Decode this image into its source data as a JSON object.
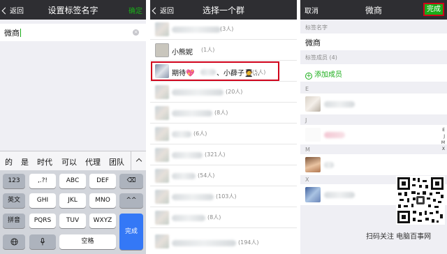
{
  "panel1": {
    "back_label": "返回",
    "title": "设置标签名字",
    "confirm_label": "确定",
    "input_value": "微商",
    "candidates": [
      "的",
      "是",
      "时代",
      "可以",
      "代理",
      "团队"
    ],
    "keys": {
      "row1": [
        "123",
        ",.?!",
        "ABC",
        "DEF"
      ],
      "row2": [
        "英文",
        "GHI",
        "JKL",
        "MNO"
      ],
      "row3": [
        "拼音",
        "PQRS",
        "TUV",
        "WXYZ"
      ],
      "space": "空格",
      "done": "完成"
    },
    "icons": {
      "backspace": "⌫",
      "emoji": "^^",
      "globe": "globe-icon",
      "mic": "microphone-icon"
    }
  },
  "panel2": {
    "back_label": "返回",
    "title": "选择一个群",
    "rows": [
      {
        "name": "",
        "count": "(3人)"
      },
      {
        "name": "小熊妮",
        "count": "(1人)"
      },
      {
        "name": "期待💖",
        "name_tail": "、小薛子🧑‍🎓...",
        "count": "(5人)"
      },
      {
        "name": "",
        "count": "(20人)"
      },
      {
        "name": "",
        "count": "(8人)"
      },
      {
        "name": "",
        "count": "(6人)"
      },
      {
        "name": "",
        "count": "(321人)"
      },
      {
        "name": "",
        "count": "(54人)"
      },
      {
        "name": "",
        "count": "(103人)"
      },
      {
        "name": "",
        "count": "(8人)"
      },
      {
        "name": "",
        "count": "(194人)"
      }
    ]
  },
  "panel3": {
    "cancel_label": "取消",
    "title": "微商",
    "done_label": "完成",
    "tag_name_label": "标签名字",
    "tag_name_value": "微商",
    "members_label": "标签成员 (4)",
    "add_member_label": "添加成员",
    "sections": [
      "E",
      "J",
      "M",
      "X"
    ],
    "index_letters": [
      "E",
      "J",
      "M",
      "X"
    ]
  },
  "watermark": {
    "caption": "扫码关注 电脑百事网"
  },
  "colors": {
    "nav_bg": "#2e2e32",
    "wechat_green": "#1aad19",
    "highlight_red": "#d0021b",
    "keyboard_bg": "#d2d5db",
    "ios_blue": "#3478f6"
  }
}
